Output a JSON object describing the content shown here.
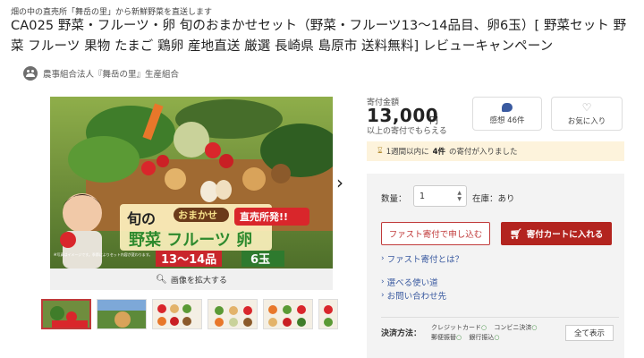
{
  "header": {
    "tagline": "畑の中の直売所「舞岳の里」から新鮮野菜を直送します",
    "title": "CA025 野菜・フルーツ・卵 旬のおまかせセット（野菜・フルーツ13～14品目、卵6玉）[ 野菜セット 野菜 フルーツ 果物 たまご 鶏卵 産地直送 厳選 長崎県 島原市 送料無料] レビューキャンペーン"
  },
  "organization": {
    "name": "農事組合法人『舞岳の里』生産組合",
    "icon": "people-icon"
  },
  "gallery": {
    "main_image_texts": {
      "shun": "旬の",
      "omakase": "おまかせ",
      "vegetables": "野菜 フルーツ 卵",
      "count_items": "13～14品",
      "eggs": "6玉",
      "store": "直売所発!!",
      "disclaimer": "※写真はイメージです。季節によりセット内容が変わります。"
    },
    "zoom_label": "画像を拡大する",
    "zoom_icon": "search-icon",
    "next_icon": "chevron-right-icon",
    "thumbnail_count": 6
  },
  "pricing": {
    "label": "寄付金額",
    "amount": "13,000",
    "unit": "円",
    "note": "以上の寄付でもらえる"
  },
  "actions": {
    "reviews_label": "感想 46件",
    "favorite_label": "お気に入り"
  },
  "notice": {
    "prefix": "1週間以内に",
    "count": "4件",
    "suffix": "の寄付が入りました"
  },
  "purchase": {
    "quantity_label": "数量：",
    "quantity_value": "1",
    "stock_label": "在庫：あり",
    "fast_button": "ファスト寄付で申し込む",
    "cart_button": "寄付カートに入れる"
  },
  "links": {
    "fast_what": "ファスト寄付とは？",
    "usage": "選べる使い道",
    "contact": "お問い合わせ先"
  },
  "payment": {
    "label": "決済方法：",
    "methods": [
      "クレジットカード",
      "コンビニ決済",
      "郵便振替",
      "銀行振込"
    ],
    "show_all": "全て表示"
  },
  "colors": {
    "accent_red": "#b3241f",
    "link_blue": "#3a5aa0",
    "notice_bg": "#fdf3dc"
  }
}
